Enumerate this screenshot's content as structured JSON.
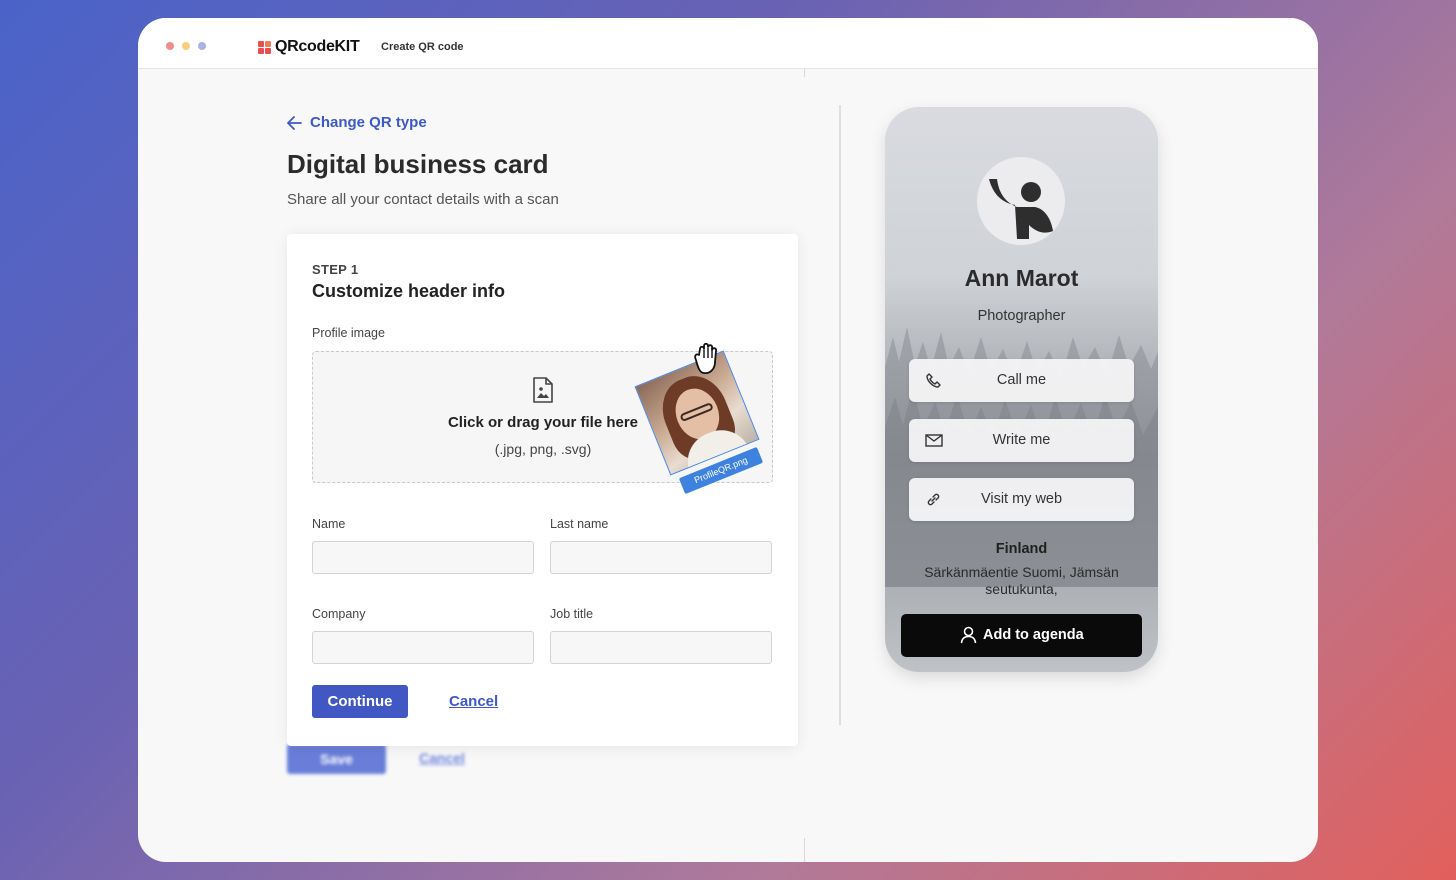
{
  "window": {
    "dots": [
      "#f28b8b",
      "#f5cf7a",
      "#a9b2e0"
    ],
    "logo_text": "QRcodeKIT",
    "nav_link": "Create QR code"
  },
  "header": {
    "back_label": "Change QR type",
    "title": "Digital business card",
    "subtitle": "Share all your contact details with a scan"
  },
  "form": {
    "step": "STEP 1",
    "title": "Customize header info",
    "profile_label": "Profile image",
    "dropzone_main": "Click or drag your file here",
    "dropzone_sub": "(.jpg, png, .svg)",
    "file_tag": "ProfileQR.png",
    "fields": {
      "name_label": "Name",
      "last_name_label": "Last name",
      "company_label": "Company",
      "job_title_label": "Job title",
      "name_value": "",
      "last_name_value": "",
      "company_value": "",
      "job_title_value": ""
    },
    "continue_label": "Continue",
    "cancel_label": "Cancel"
  },
  "ghost": {
    "save_label": "Save",
    "cancel_label": "Cancel"
  },
  "preview": {
    "name": "Ann Marot",
    "role": "Photographer",
    "buttons": {
      "call": "Call me",
      "write": "Write me",
      "web": "Visit my web"
    },
    "country": "Finland",
    "address": "Särkänmäentie Suomi, Jämsän seutukunta,",
    "agenda_label": "Add to agenda"
  },
  "colors": {
    "accent": "#4057c4",
    "link": "#3f58c8",
    "brand": "#e84e4e"
  }
}
